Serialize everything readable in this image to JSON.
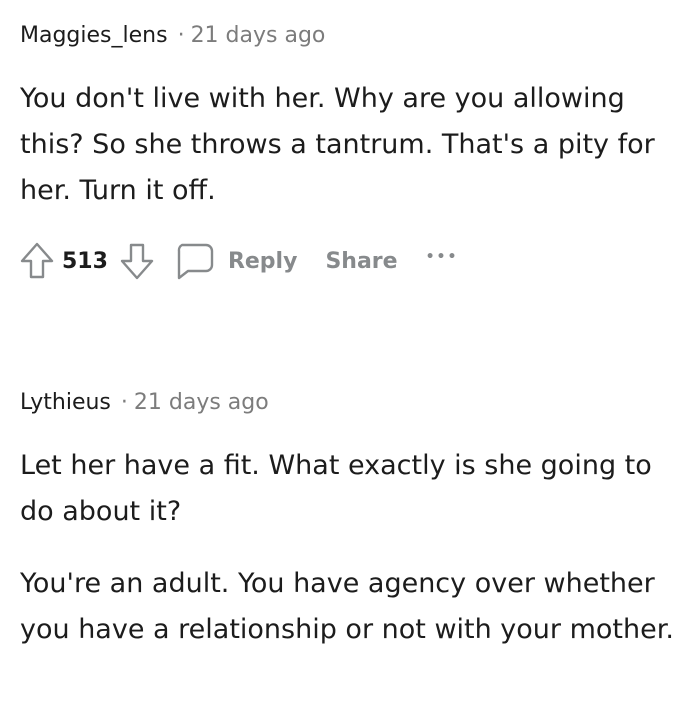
{
  "comments": [
    {
      "author": "Maggies_lens",
      "separator": "·",
      "time": "21 days ago",
      "paragraphs": [
        "You don't live with her. Why are you allowing this? So she throws a tantrum. That's a pity for her. Turn it off."
      ],
      "actions": {
        "upvote_icon": "arrow-up-icon",
        "score": "513",
        "downvote_icon": "arrow-down-icon",
        "reply_icon": "speech-bubble-icon",
        "reply_label": "Reply",
        "share_label": "Share",
        "more_label": "•••"
      }
    },
    {
      "author": "Lythieus",
      "separator": "·",
      "time": "21 days ago",
      "paragraphs": [
        "Let her have a fit. What exactly is she going to do about it?",
        "You're an adult. You have agency over whether you have a relationship or not with your mother."
      ]
    }
  ],
  "colors": {
    "text": "#1c1c1c",
    "muted": "#7c7c7c",
    "action": "#878a8c"
  }
}
